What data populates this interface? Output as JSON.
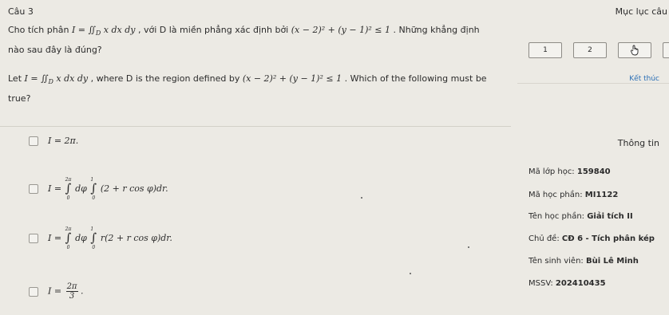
{
  "question": {
    "number_label": "Câu 3",
    "vi_prefix": "Cho tích phân ",
    "vi_integral": "I = ∬",
    "vi_region": "D",
    "vi_integrand": "x dx dy",
    "vi_middle": ", với D là miền phẳng xác định bởi ",
    "vi_condition": "(x − 2)² + (y − 1)² ≤ 1",
    "vi_suffix": ". Những khẳng định",
    "vi_line2": "nào sau đây là đúng?",
    "en_prefix": "Let ",
    "en_integral": "I = ∬",
    "en_region": "D",
    "en_integrand": "x dx dy",
    "en_middle": ", where D is the region defined by ",
    "en_condition": "(x − 2)² + (y − 1)² ≤ 1",
    "en_suffix": ". Which of the following must be",
    "en_line2": "true?"
  },
  "options": [
    {
      "text": "I = 2π."
    },
    {
      "lhs": "I = ",
      "int1_top": "2π",
      "int1_bot": "0",
      "dphi": "dφ",
      "int2_top": "1",
      "int2_bot": "0",
      "integrand": "(2 + r cos φ)dr."
    },
    {
      "lhs": "I = ",
      "int1_top": "2π",
      "int1_bot": "0",
      "dphi": "dφ",
      "int2_top": "1",
      "int2_bot": "0",
      "integrand": "r(2 + r cos φ)dr."
    },
    {
      "lhs": "I = ",
      "num": "2π",
      "den": "3",
      "tail": "."
    }
  ],
  "sidebar": {
    "menu_title": "Mục lục câu",
    "nav_buttons": [
      "1",
      "2"
    ],
    "finish_label": "Kết thúc",
    "info_title": "Thông tin",
    "class_label": "Mã lớp học:",
    "class_value": "159840",
    "course_code_label": "Mã học phần:",
    "course_code_value": "MI1122",
    "course_name_label": "Tên học phần:",
    "course_name_value": "Giải tích II",
    "topic_label": "Chủ đề:",
    "topic_value": "CĐ 6 - Tích phân kép",
    "student_label": "Tên sinh viên:",
    "student_value": "Bùi Lê Minh",
    "id_label": "MSSV:",
    "id_value": "202410435"
  }
}
